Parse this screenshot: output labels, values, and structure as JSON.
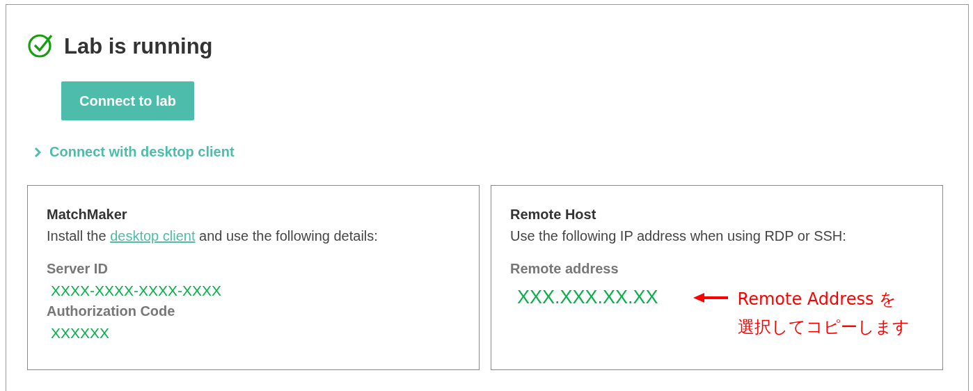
{
  "status": {
    "title": "Lab is running",
    "running": true
  },
  "connect_button": {
    "label": "Connect to lab"
  },
  "expander": {
    "label": "Connect with desktop client",
    "expanded": false
  },
  "cards": [
    {
      "title": "MatchMaker",
      "description": {
        "before": "Install the ",
        "link": "desktop client",
        "after": " and use the following details:"
      },
      "fields": [
        {
          "label": "Server ID",
          "value": "XXXX-XXXX-XXXX-XXXX"
        },
        {
          "label": "Authorization Code",
          "value": "XXXXXX"
        }
      ]
    },
    {
      "title": "Remote Host",
      "description": {
        "before": "Use the following IP address when using RDP or SSH:"
      },
      "fields": [
        {
          "label": "Remote address",
          "value": "XXX.XXX.XX.XX"
        }
      ],
      "annotation": {
        "lines": [
          "Remote Address を",
          "選択してコピーします"
        ]
      }
    }
  ]
}
